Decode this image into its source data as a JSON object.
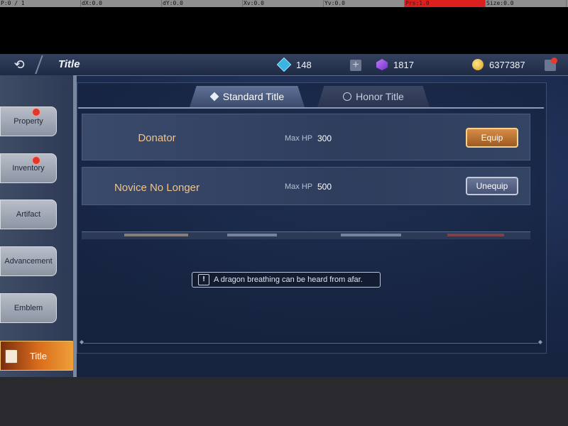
{
  "debug_bar": [
    "P:0 / 1",
    "dX:0.0",
    "dY:0.0",
    "Xv:0.0",
    "Yv:0.0",
    "Prs:1.0",
    "Size:0.0"
  ],
  "header": {
    "back_icon": "back-arrow-icon",
    "title": "Title",
    "currencies": [
      {
        "name": "gem",
        "icon": "blue-gem-icon",
        "value": "148"
      },
      {
        "name": "crystal",
        "icon": "purple-crystal-icon",
        "value": "1817"
      },
      {
        "name": "gold",
        "icon": "gold-coin-icon",
        "value": "6377387"
      }
    ]
  },
  "sidebar": {
    "items": [
      {
        "label": "Property",
        "badge": true
      },
      {
        "label": "Inventory",
        "badge": true
      },
      {
        "label": "Artifact",
        "badge": false
      },
      {
        "label": "Advancement",
        "badge": false
      },
      {
        "label": "Emblem",
        "badge": false
      },
      {
        "label": "Title",
        "badge": false,
        "active": true
      }
    ]
  },
  "tabs": [
    {
      "label": "Standard Title",
      "icon": "diamond-icon",
      "active": true
    },
    {
      "label": "Honor Title",
      "icon": "clock-icon",
      "active": false
    }
  ],
  "titles": [
    {
      "name": "Donator",
      "stat_label": "Max HP",
      "stat_value": "300",
      "action": "Equip"
    },
    {
      "name": "Novice No Longer",
      "stat_label": "Max HP",
      "stat_value": "500",
      "action": "Unequip"
    }
  ],
  "toast": {
    "icon": "warning-icon",
    "text": "A dragon breathing can be heard from afar."
  },
  "colors": {
    "accent_orange": "#d58d47",
    "panel_blue": "#1d2d52",
    "badge_red": "#e0372a",
    "title_gold": "#f0c48a"
  }
}
